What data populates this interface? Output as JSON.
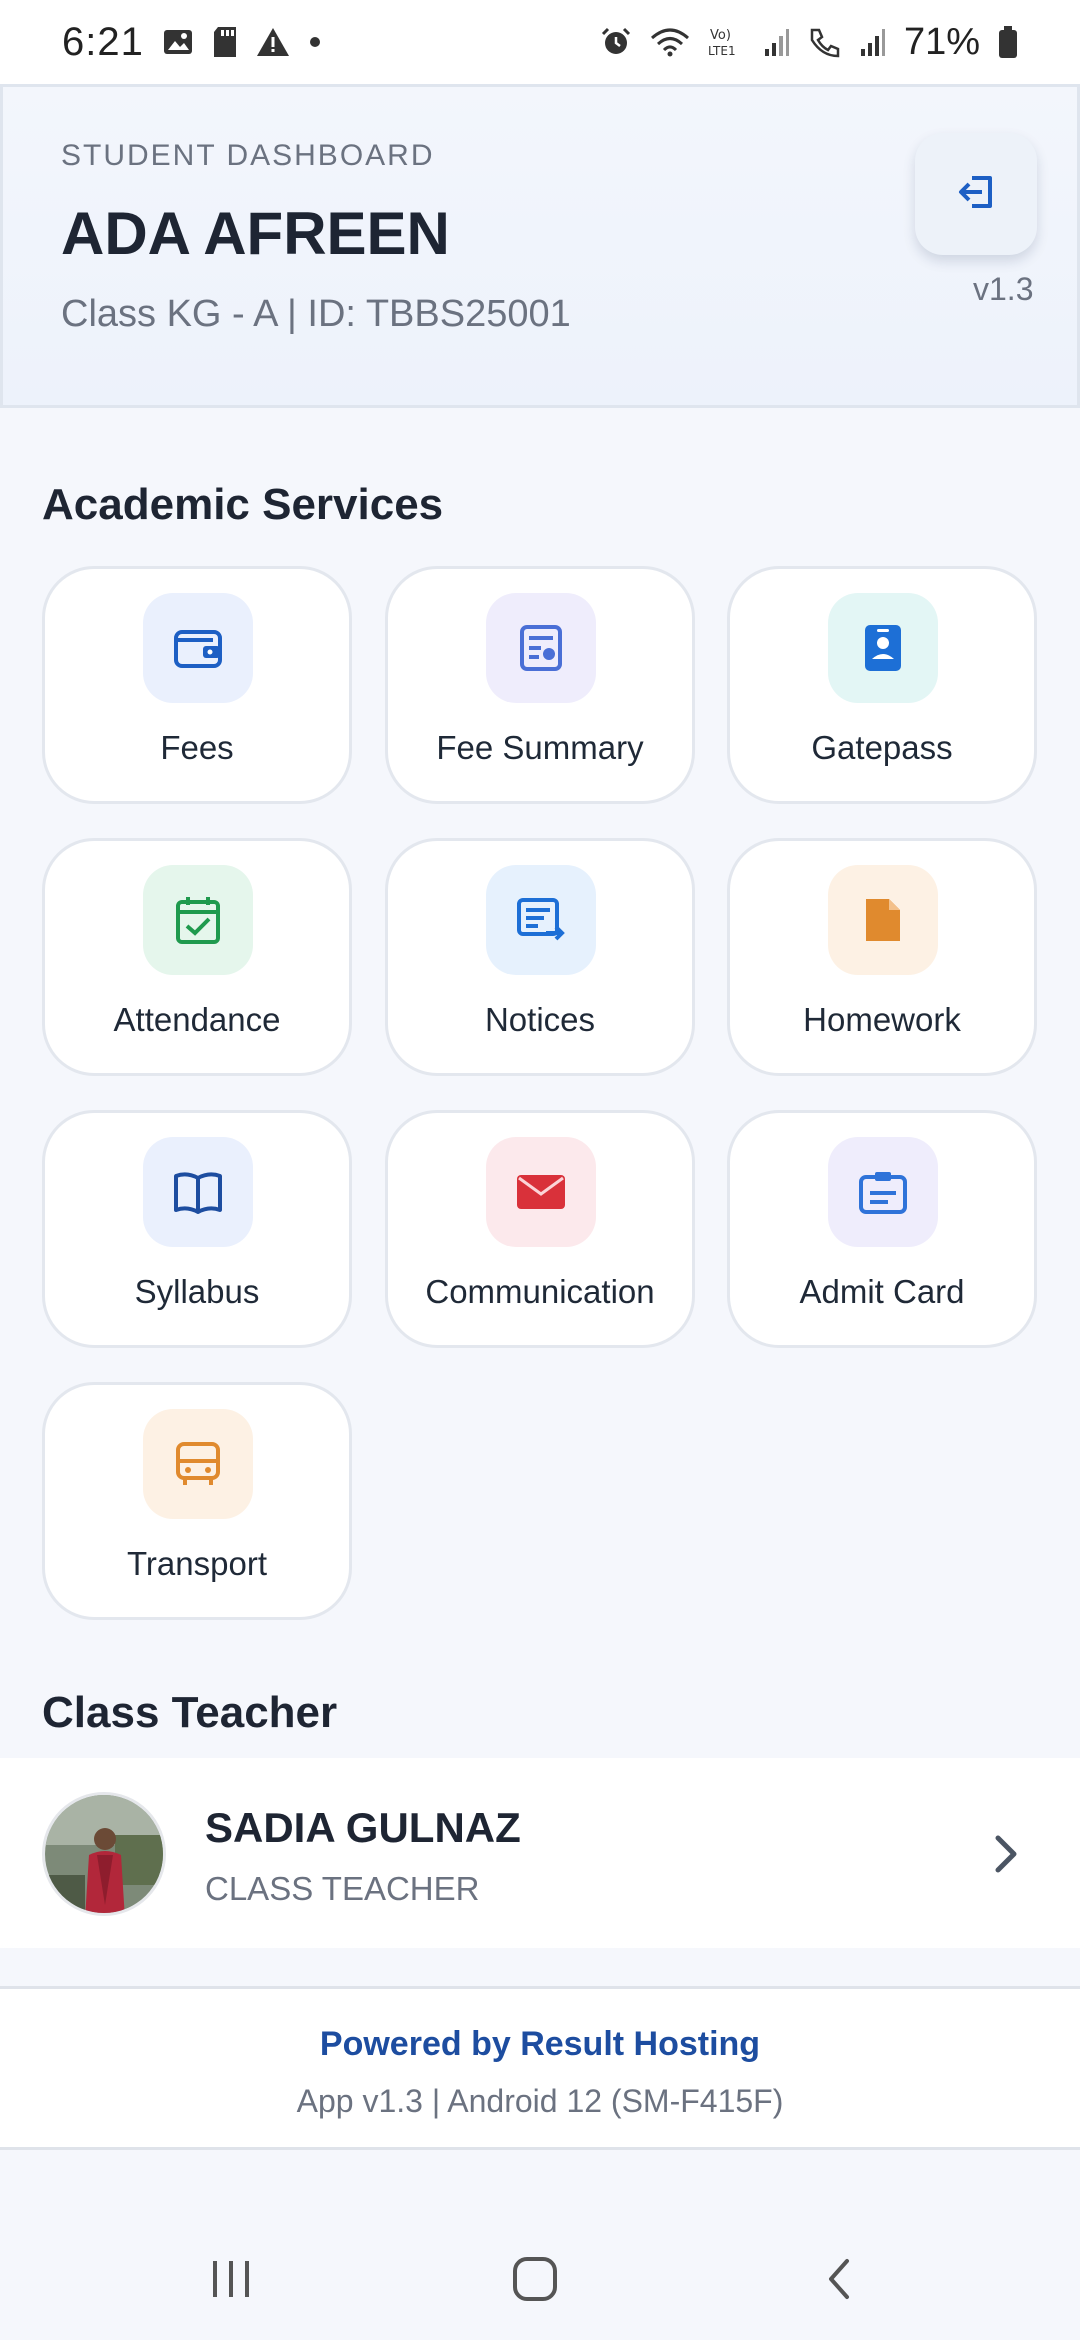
{
  "status_bar": {
    "time": "6:21",
    "battery": "71%"
  },
  "header": {
    "caption": "STUDENT DASHBOARD",
    "name": "ADA AFREEN",
    "subtitle": "Class KG - A | ID: TBBS25001",
    "version": "v1.3"
  },
  "academic": {
    "title": "Academic Services",
    "tiles": [
      {
        "label": "Fees",
        "icon": "wallet-icon"
      },
      {
        "label": "Fee Summary",
        "icon": "receipt-icon"
      },
      {
        "label": "Gatepass",
        "icon": "badge-icon"
      },
      {
        "label": "Attendance",
        "icon": "calendar-check-icon"
      },
      {
        "label": "Notices",
        "icon": "notice-icon"
      },
      {
        "label": "Homework",
        "icon": "document-icon"
      },
      {
        "label": "Syllabus",
        "icon": "book-icon"
      },
      {
        "label": "Communication",
        "icon": "envelope-icon"
      },
      {
        "label": "Admit Card",
        "icon": "clipboard-icon"
      },
      {
        "label": "Transport",
        "icon": "bus-icon"
      }
    ]
  },
  "teacher": {
    "title": "Class Teacher",
    "name": "SADIA GULNAZ",
    "role": "CLASS TEACHER"
  },
  "footer": {
    "powered": "Powered by Result Hosting",
    "app_info": "App v1.3 | Android 12 (SM-F415F)"
  },
  "colors": {
    "accent": "#1d4da0",
    "background": "#f5f7fc"
  }
}
